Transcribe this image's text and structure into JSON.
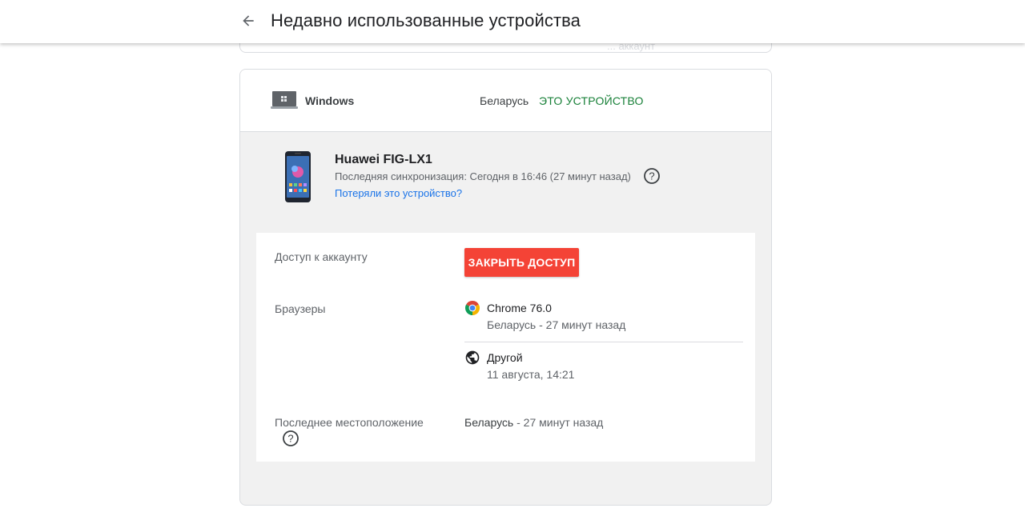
{
  "header": {
    "title": "Недавно использованные устройства",
    "hidden_text": "... аккаунт"
  },
  "current_device": {
    "name": "Windows",
    "country": "Беларусь",
    "badge": "ЭТО УСТРОЙСТВО",
    "badge_color": "#188038",
    "icon": "laptop-icon"
  },
  "device": {
    "name": "Huawei FIG-LX1",
    "sync": "Последняя синхронизация: Сегодня в 16:46 (27 минут назад)",
    "lost_link": "Потеряли это устройство?",
    "icon": "smartphone-icon"
  },
  "details": {
    "access_label": "Доступ к аккаунту",
    "close_access_button": "ЗАКРЫТЬ ДОСТУП",
    "button_color": "#f44336",
    "browsers_label": "Браузеры",
    "browsers": [
      {
        "name": "Chrome 76.0",
        "meta": "Беларусь - 27 минут назад",
        "icon": "chrome-icon"
      },
      {
        "name": "Другой",
        "meta": "11 августа, 14:21",
        "icon": "globe-icon"
      }
    ],
    "location_label": "Последнее местоположение",
    "location_country": "Беларусь",
    "location_time": " - 27 минут назад"
  }
}
